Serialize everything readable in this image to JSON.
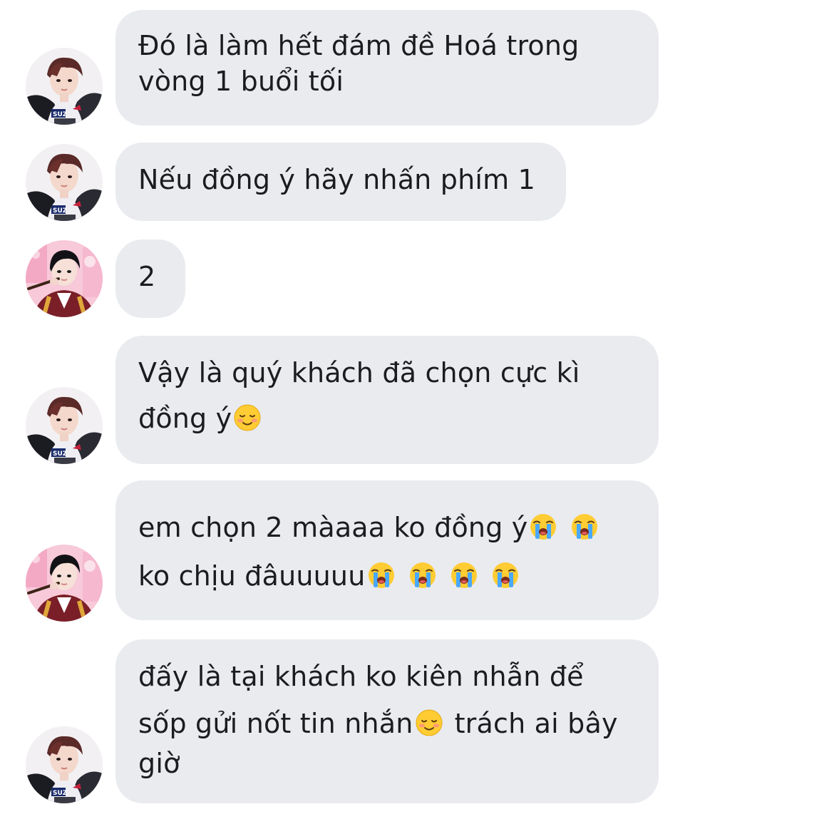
{
  "chat": {
    "messages": [
      {
        "sender": "user-a",
        "lines": [
          "Đó là làm hết đám đề Hoá trong",
          "vòng 1 buổi tối"
        ]
      },
      {
        "sender": "user-a",
        "lines": [
          "Nếu đồng ý hãy nhấn phím 1"
        ]
      },
      {
        "sender": "user-b",
        "lines": [
          "2"
        ]
      },
      {
        "sender": "user-a",
        "lines": [
          "Vậy là quý khách đã chọn cực kì",
          "đồng ý"
        ]
      },
      {
        "sender": "user-b",
        "lines": [
          "em chọn 2 màaaa ko đồng ý",
          "ko chịu đâuuuuu"
        ]
      },
      {
        "sender": "user-a",
        "lines": [
          "đấy là tại khách ko kiên nhẫn để",
          "sốp gửi nốt tin nhắn",
          "trách ai bây",
          "giờ"
        ]
      }
    ],
    "emoji": {
      "smiling_blush": "smiling-face-icon",
      "crying": "loudly-crying-face-icon"
    }
  },
  "colors": {
    "bubble": "#e9ebef",
    "text": "#1c1c1e",
    "background": "#ffffff"
  }
}
